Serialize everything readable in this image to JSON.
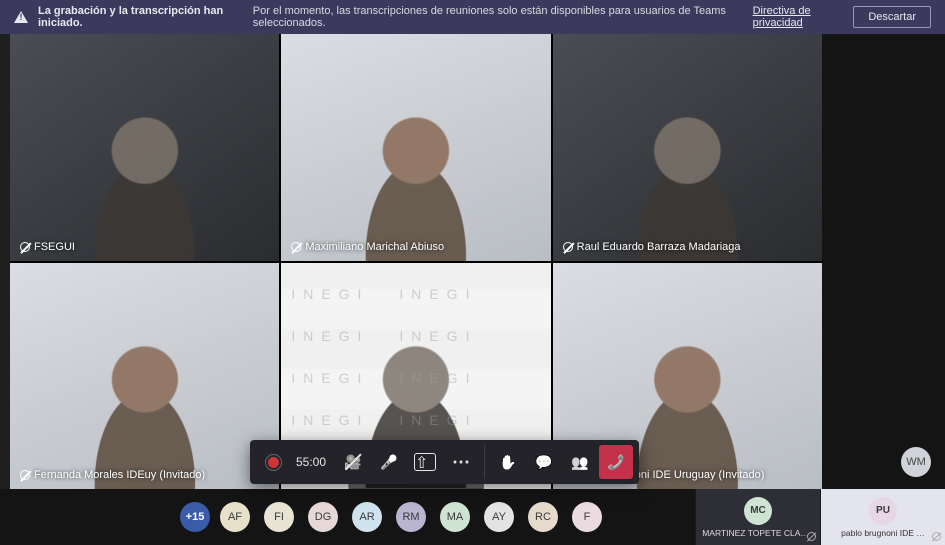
{
  "banner": {
    "title": "La grabación y la transcripción han iniciado.",
    "message": "Por el momento, las transcripciones de reuniones solo están disponibles para usuarios de Teams seleccionados.",
    "link": "Directiva de privacidad",
    "dismiss": "Descartar"
  },
  "controls": {
    "timer": "55:00"
  },
  "tiles": [
    {
      "name": "FSEGUI",
      "muted": true
    },
    {
      "name": "Maximiliano Marichal Abiuso",
      "muted": true
    },
    {
      "name": "Raul Eduardo Barraza Madariaga",
      "muted": true
    },
    {
      "name": "Fernanda Morales IDEuy (Invitado)",
      "muted": true
    },
    {
      "name": "MARTINEZ TOPETE CLAUDIO",
      "muted": false,
      "boxed": true
    },
    {
      "name": "pablo brugnoni IDE Uruguay (Invitado)",
      "muted": true
    }
  ],
  "overflow": "+15",
  "avatars": [
    {
      "initials": "AF",
      "bg": "#e8e0c8"
    },
    {
      "initials": "FI",
      "bg": "#e8e4d4"
    },
    {
      "initials": "DG",
      "bg": "#e7d8d8"
    },
    {
      "initials": "AR",
      "bg": "#cfe3ef"
    },
    {
      "initials": "RM",
      "bg": "#b9b4cf"
    },
    {
      "initials": "MA",
      "bg": "#cfe3d2"
    },
    {
      "initials": "AY",
      "bg": "#e3e3e3"
    },
    {
      "initials": "RC",
      "bg": "#e6dacb"
    },
    {
      "initials": "F",
      "bg": "#eadbe1"
    }
  ],
  "spotlight": [
    {
      "initials": "MC",
      "name": "MARTINEZ TOPETE CLAUD…",
      "avbg": "#cfe3d2",
      "cardbg": "#2e2e36"
    },
    {
      "initials": "PU",
      "name": "pablo brugnoni IDE …",
      "avbg": "#e6d6e6",
      "cardbg": "#e4e4ee",
      "dark_text": true
    }
  ],
  "far_avatar": "WM"
}
